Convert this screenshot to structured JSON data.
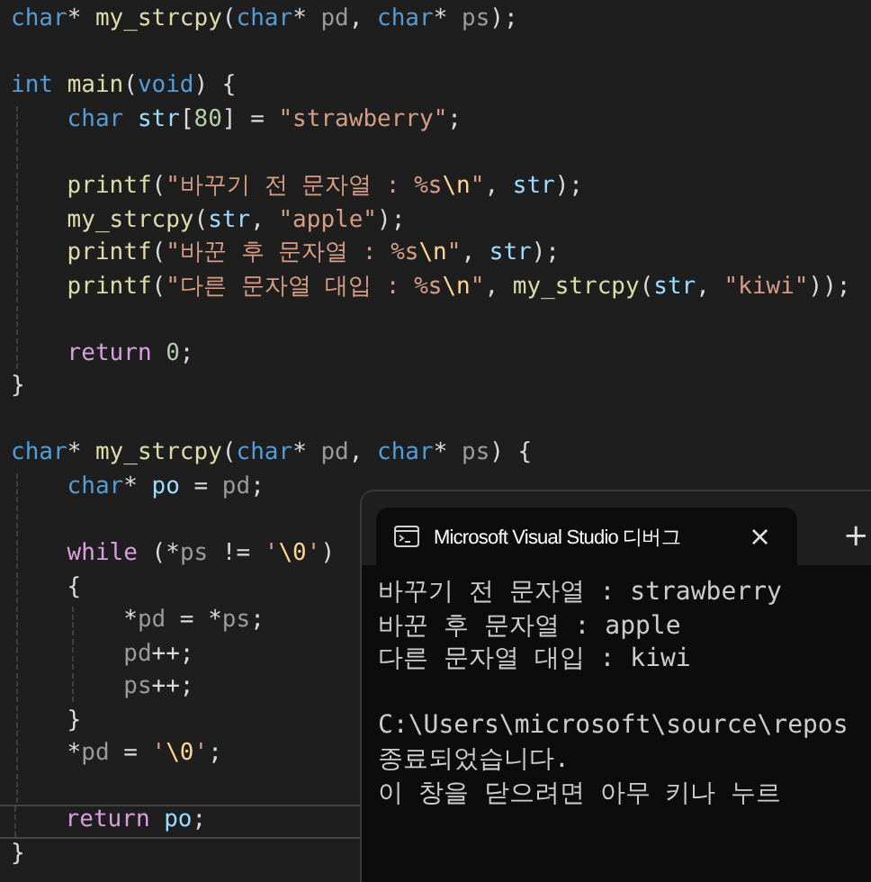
{
  "editor": {
    "lines": [
      {
        "current": false,
        "tokens": [
          {
            "kind": "keyword",
            "text": "char"
          },
          {
            "kind": "plain",
            "text": "* "
          },
          {
            "kind": "function",
            "text": "my_strcpy"
          },
          {
            "kind": "plain",
            "text": "("
          },
          {
            "kind": "keyword",
            "text": "char"
          },
          {
            "kind": "plain",
            "text": "* "
          },
          {
            "kind": "param",
            "text": "pd"
          },
          {
            "kind": "plain",
            "text": ", "
          },
          {
            "kind": "keyword",
            "text": "char"
          },
          {
            "kind": "plain",
            "text": "* "
          },
          {
            "kind": "param",
            "text": "ps"
          },
          {
            "kind": "plain",
            "text": ");"
          }
        ]
      },
      {
        "current": false
      },
      {
        "current": false,
        "tokens": [
          {
            "kind": "keyword",
            "text": "int "
          },
          {
            "kind": "function",
            "text": "main"
          },
          {
            "kind": "plain",
            "text": "("
          },
          {
            "kind": "keyword",
            "text": "void"
          },
          {
            "kind": "plain",
            "text": ") {"
          }
        ]
      },
      {
        "current": false,
        "tokens": [
          {
            "kind": "keyword",
            "text": "    char "
          },
          {
            "kind": "variable",
            "text": "str"
          },
          {
            "kind": "plain",
            "text": "["
          },
          {
            "kind": "number",
            "text": "80"
          },
          {
            "kind": "plain",
            "text": "] = "
          },
          {
            "kind": "string",
            "text": "\"strawberry\""
          },
          {
            "kind": "plain",
            "text": ";"
          }
        ]
      },
      {
        "current": false
      },
      {
        "current": false,
        "tokens": [
          {
            "kind": "function",
            "text": "    printf"
          },
          {
            "kind": "plain",
            "text": "("
          },
          {
            "kind": "string",
            "text": "\"바꾸기 전 문자열 : %s"
          },
          {
            "kind": "escape",
            "text": "\\n"
          },
          {
            "kind": "string",
            "text": "\""
          },
          {
            "kind": "plain",
            "text": ", "
          },
          {
            "kind": "variable",
            "text": "str"
          },
          {
            "kind": "plain",
            "text": ");"
          }
        ]
      },
      {
        "current": false,
        "tokens": [
          {
            "kind": "function",
            "text": "    my_strcpy"
          },
          {
            "kind": "plain",
            "text": "("
          },
          {
            "kind": "variable",
            "text": "str"
          },
          {
            "kind": "plain",
            "text": ", "
          },
          {
            "kind": "string",
            "text": "\"apple\""
          },
          {
            "kind": "plain",
            "text": ");"
          }
        ]
      },
      {
        "current": false,
        "tokens": [
          {
            "kind": "function",
            "text": "    printf"
          },
          {
            "kind": "plain",
            "text": "("
          },
          {
            "kind": "string",
            "text": "\"바꾼 후 문자열 : %s"
          },
          {
            "kind": "escape",
            "text": "\\n"
          },
          {
            "kind": "string",
            "text": "\""
          },
          {
            "kind": "plain",
            "text": ", "
          },
          {
            "kind": "variable",
            "text": "str"
          },
          {
            "kind": "plain",
            "text": ");"
          }
        ]
      },
      {
        "current": false,
        "tokens": [
          {
            "kind": "function",
            "text": "    printf"
          },
          {
            "kind": "plain",
            "text": "("
          },
          {
            "kind": "string",
            "text": "\"다른 문자열 대입 : %s"
          },
          {
            "kind": "escape",
            "text": "\\n"
          },
          {
            "kind": "string",
            "text": "\""
          },
          {
            "kind": "plain",
            "text": ", "
          },
          {
            "kind": "function",
            "text": "my_strcpy"
          },
          {
            "kind": "plain",
            "text": "("
          },
          {
            "kind": "variable",
            "text": "str"
          },
          {
            "kind": "plain",
            "text": ", "
          },
          {
            "kind": "string",
            "text": "\"kiwi\""
          },
          {
            "kind": "plain",
            "text": "));"
          }
        ]
      },
      {
        "current": false
      },
      {
        "current": false,
        "tokens": [
          {
            "kind": "control",
            "text": "    return "
          },
          {
            "kind": "number",
            "text": "0"
          },
          {
            "kind": "plain",
            "text": ";"
          }
        ]
      },
      {
        "current": false,
        "tokens": [
          {
            "kind": "plain",
            "text": "}"
          }
        ]
      },
      {
        "current": false
      },
      {
        "current": false,
        "tokens": [
          {
            "kind": "keyword",
            "text": "char"
          },
          {
            "kind": "plain",
            "text": "* "
          },
          {
            "kind": "function",
            "text": "my_strcpy"
          },
          {
            "kind": "plain",
            "text": "("
          },
          {
            "kind": "keyword",
            "text": "char"
          },
          {
            "kind": "plain",
            "text": "* "
          },
          {
            "kind": "param",
            "text": "pd"
          },
          {
            "kind": "plain",
            "text": ", "
          },
          {
            "kind": "keyword",
            "text": "char"
          },
          {
            "kind": "plain",
            "text": "* "
          },
          {
            "kind": "param",
            "text": "ps"
          },
          {
            "kind": "plain",
            "text": ") {"
          }
        ]
      },
      {
        "current": false,
        "tokens": [
          {
            "kind": "keyword",
            "text": "    char"
          },
          {
            "kind": "plain",
            "text": "* "
          },
          {
            "kind": "variable",
            "text": "po"
          },
          {
            "kind": "plain",
            "text": " = "
          },
          {
            "kind": "param",
            "text": "pd"
          },
          {
            "kind": "plain",
            "text": ";"
          }
        ]
      },
      {
        "current": false
      },
      {
        "current": false,
        "tokens": [
          {
            "kind": "control",
            "text": "    while"
          },
          {
            "kind": "plain",
            "text": " (*"
          },
          {
            "kind": "param",
            "text": "ps"
          },
          {
            "kind": "plain",
            "text": " != "
          },
          {
            "kind": "string",
            "text": "'"
          },
          {
            "kind": "escape",
            "text": "\\0"
          },
          {
            "kind": "string",
            "text": "'"
          },
          {
            "kind": "plain",
            "text": ")"
          }
        ]
      },
      {
        "current": false,
        "tokens": [
          {
            "kind": "plain",
            "text": "    {"
          }
        ]
      },
      {
        "current": false,
        "tokens": [
          {
            "kind": "plain",
            "text": "        *"
          },
          {
            "kind": "param",
            "text": "pd"
          },
          {
            "kind": "plain",
            "text": " = *"
          },
          {
            "kind": "param",
            "text": "ps"
          },
          {
            "kind": "plain",
            "text": ";"
          }
        ]
      },
      {
        "current": false,
        "tokens": [
          {
            "kind": "param",
            "text": "        pd"
          },
          {
            "kind": "plain",
            "text": "++;"
          }
        ]
      },
      {
        "current": false,
        "tokens": [
          {
            "kind": "param",
            "text": "        ps"
          },
          {
            "kind": "plain",
            "text": "++;"
          }
        ]
      },
      {
        "current": false,
        "tokens": [
          {
            "kind": "plain",
            "text": "    }"
          }
        ]
      },
      {
        "current": false,
        "tokens": [
          {
            "kind": "plain",
            "text": "    *"
          },
          {
            "kind": "param",
            "text": "pd"
          },
          {
            "kind": "plain",
            "text": " = "
          },
          {
            "kind": "string",
            "text": "'"
          },
          {
            "kind": "escape",
            "text": "\\0"
          },
          {
            "kind": "string",
            "text": "'"
          },
          {
            "kind": "plain",
            "text": ";"
          }
        ]
      },
      {
        "current": false
      },
      {
        "current": true,
        "tokens": [
          {
            "kind": "control",
            "text": "    return "
          },
          {
            "kind": "variable",
            "text": "po"
          },
          {
            "kind": "plain",
            "text": ";"
          }
        ]
      },
      {
        "current": false,
        "tokens": [
          {
            "kind": "plain",
            "text": "}"
          }
        ]
      }
    ]
  },
  "terminal": {
    "tab": {
      "title": "Microsoft Visual Studio 디버그",
      "close": "×",
      "new_tab": "+"
    },
    "blocks": [
      {
        "lines": [
          "바꾸기 전 문자열 : strawberry",
          "바꾼 후 문자열 : apple",
          "다른 문자열 대입 : kiwi"
        ]
      },
      {
        "lines": [
          "C:\\Users\\microsoft\\source\\repos",
          "종료되었습니다.",
          "이 창을 닫으려면 아무 키나 누르"
        ]
      }
    ]
  }
}
